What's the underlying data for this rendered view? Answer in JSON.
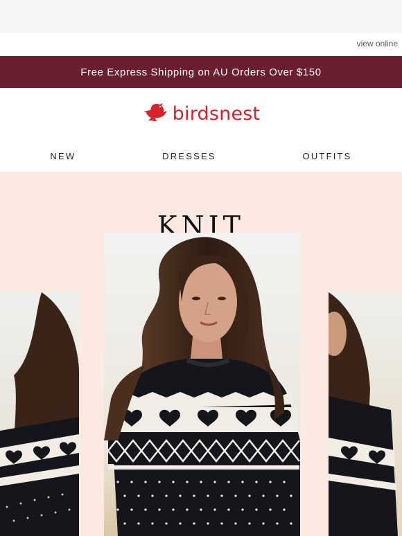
{
  "header": {
    "view_online": "view online"
  },
  "promo": {
    "text": "Free Express Shipping on AU Orders Over $150",
    "bg_color": "#6b1f2e"
  },
  "logo": {
    "text": "birdsnest",
    "icon": "bird-icon",
    "color": "#d8232a"
  },
  "nav": {
    "items": [
      {
        "label": "NEW"
      },
      {
        "label": "DRESSES"
      },
      {
        "label": "OUTFITS"
      }
    ]
  },
  "hero": {
    "title": "KNIT",
    "bg_color": "#fbe9e2",
    "image": "woman-in-heart-fair-isle-knit-sweater"
  }
}
